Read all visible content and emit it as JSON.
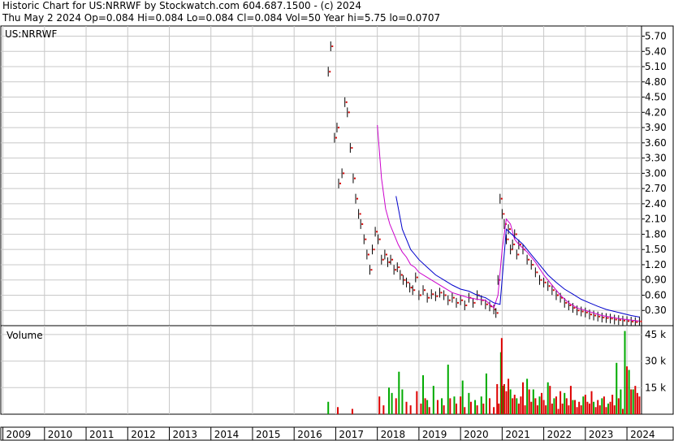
{
  "header": {
    "line1": "Historic Chart for US:NRRWF by Stockwatch.com 604.687.1500 - (c) 2024",
    "line2": "Thu May  2 2024  Op=0.084  Hi=0.084  Lo=0.084  Cl=0.084  Vol=50  Year hi=5.75  lo=0.0707"
  },
  "chart_data": [
    {
      "type": "line",
      "title": "US:NRRWF",
      "ylim": [
        0,
        5.9
      ],
      "ytick_labels": [
        "0.30",
        "0.60",
        "0.90",
        "1.20",
        "1.50",
        "1.80",
        "2.10",
        "2.40",
        "2.70",
        "3.00",
        "3.30",
        "3.60",
        "3.90",
        "4.20",
        "4.50",
        "4.80",
        "5.10",
        "5.40",
        "5.70"
      ],
      "x_labels": [
        "2009",
        "2010",
        "2011",
        "2012",
        "2013",
        "2014",
        "2015",
        "2016",
        "2017",
        "2018",
        "2019",
        "2020",
        "2021",
        "2022",
        "2023",
        "2024"
      ],
      "x_domain": [
        2008.95,
        2024.35
      ],
      "grid": true,
      "colors": {
        "price": "#000000",
        "close_dots": "#d40000",
        "ma_short": "#cc00cc",
        "ma_long": "#0000cc"
      },
      "series": [
        {
          "role": "price",
          "x": [
            2016.82,
            2016.88,
            2016.97,
            2017.03,
            2017.07,
            2017.15,
            2017.22,
            2017.28,
            2017.35,
            2017.42,
            2017.48,
            2017.55,
            2017.6,
            2017.68,
            2017.75,
            2017.82,
            2017.88,
            2017.95,
            2018.02,
            2018.1,
            2018.18,
            2018.25,
            2018.32,
            2018.4,
            2018.48,
            2018.55,
            2018.62,
            2018.7,
            2018.78,
            2018.85,
            2018.92,
            2019.0,
            2019.1,
            2019.2,
            2019.3,
            2019.4,
            2019.5,
            2019.6,
            2019.7,
            2019.8,
            2019.9,
            2020.0,
            2020.1,
            2020.2,
            2020.3,
            2020.4,
            2020.5,
            2020.6,
            2020.7,
            2020.8,
            2020.85,
            2020.9,
            2020.95,
            2021.0,
            2021.05,
            2021.1,
            2021.15,
            2021.2,
            2021.25,
            2021.3,
            2021.35,
            2021.4,
            2021.5,
            2021.6,
            2021.7,
            2021.8,
            2021.9,
            2022.0,
            2022.1,
            2022.2,
            2022.3,
            2022.4,
            2022.5,
            2022.6,
            2022.7,
            2022.8,
            2022.9,
            2023.0,
            2023.1,
            2023.2,
            2023.3,
            2023.4,
            2023.5,
            2023.6,
            2023.7,
            2023.8,
            2023.9,
            2024.0,
            2024.1,
            2024.2,
            2024.3
          ],
          "y": [
            5.0,
            5.5,
            3.7,
            3.9,
            2.8,
            3.0,
            4.4,
            4.2,
            3.5,
            2.9,
            2.5,
            2.2,
            2.0,
            1.7,
            1.4,
            1.1,
            1.5,
            1.85,
            1.7,
            1.3,
            1.4,
            1.25,
            1.3,
            1.1,
            1.15,
            1.0,
            0.9,
            0.85,
            0.75,
            0.7,
            0.95,
            0.6,
            0.7,
            0.55,
            0.62,
            0.58,
            0.65,
            0.6,
            0.5,
            0.55,
            0.45,
            0.5,
            0.4,
            0.55,
            0.45,
            0.6,
            0.5,
            0.42,
            0.38,
            0.32,
            0.25,
            0.9,
            2.5,
            2.2,
            2.0,
            1.7,
            1.9,
            1.5,
            1.6,
            1.8,
            1.4,
            1.6,
            1.5,
            1.3,
            1.2,
            1.05,
            0.9,
            0.85,
            0.78,
            0.7,
            0.6,
            0.55,
            0.45,
            0.4,
            0.35,
            0.3,
            0.28,
            0.26,
            0.22,
            0.2,
            0.18,
            0.16,
            0.15,
            0.14,
            0.12,
            0.11,
            0.1,
            0.09,
            0.08,
            0.07,
            0.084
          ]
        },
        {
          "role": "ma_short",
          "x": [
            2018.0,
            2018.1,
            2018.2,
            2018.3,
            2018.4,
            2018.5,
            2018.6,
            2018.7,
            2018.8,
            2018.9,
            2019.0,
            2019.2,
            2019.4,
            2019.6,
            2019.8,
            2020.0,
            2020.2,
            2020.4,
            2020.6,
            2020.8,
            2020.9,
            2021.0,
            2021.1,
            2021.2,
            2021.3,
            2021.4,
            2021.6,
            2021.8,
            2022.0,
            2022.2,
            2022.4,
            2022.6,
            2022.8,
            2023.0,
            2023.2,
            2023.4,
            2023.6,
            2023.8,
            2024.0,
            2024.2,
            2024.3
          ],
          "y": [
            3.95,
            2.9,
            2.3,
            2.0,
            1.8,
            1.6,
            1.45,
            1.35,
            1.2,
            1.15,
            1.05,
            0.95,
            0.85,
            0.75,
            0.65,
            0.6,
            0.55,
            0.52,
            0.5,
            0.35,
            0.6,
            1.5,
            2.1,
            2.0,
            1.7,
            1.6,
            1.45,
            1.25,
            1.0,
            0.8,
            0.6,
            0.45,
            0.35,
            0.3,
            0.25,
            0.2,
            0.17,
            0.14,
            0.12,
            0.1,
            0.09
          ]
        },
        {
          "role": "ma_long",
          "x": [
            2018.45,
            2018.6,
            2018.8,
            2019.0,
            2019.2,
            2019.4,
            2019.6,
            2019.8,
            2020.0,
            2020.2,
            2020.4,
            2020.6,
            2020.8,
            2020.95,
            2021.1,
            2021.3,
            2021.5,
            2021.7,
            2021.9,
            2022.1,
            2022.3,
            2022.5,
            2022.7,
            2022.9,
            2023.1,
            2023.3,
            2023.5,
            2023.7,
            2023.9,
            2024.1,
            2024.3
          ],
          "y": [
            2.55,
            1.9,
            1.5,
            1.3,
            1.15,
            1.0,
            0.9,
            0.8,
            0.72,
            0.68,
            0.6,
            0.55,
            0.45,
            0.42,
            1.9,
            1.75,
            1.6,
            1.4,
            1.2,
            1.0,
            0.85,
            0.72,
            0.62,
            0.52,
            0.45,
            0.38,
            0.32,
            0.28,
            0.24,
            0.2,
            0.17
          ]
        }
      ]
    },
    {
      "type": "bar",
      "title": "Volume",
      "ylim": [
        0,
        50
      ],
      "ytick_labels": [
        "15 k",
        "30 k",
        "45 k"
      ],
      "colors": {
        "up": "#00aa00",
        "down": "#dd0000"
      },
      "series": [
        {
          "role": "up",
          "x": [
            2016.82,
            2018.28,
            2018.35,
            2018.52,
            2018.6,
            2019.1,
            2019.2,
            2019.35,
            2019.55,
            2019.7,
            2019.85,
            2020.05,
            2020.2,
            2020.35,
            2020.5,
            2020.62,
            2020.97,
            2021.02,
            2021.2,
            2021.35,
            2021.6,
            2021.75,
            2021.9,
            2022.1,
            2022.25,
            2022.5,
            2022.7,
            2022.95,
            2023.2,
            2023.4,
            2023.55,
            2023.75,
            2023.85,
            2023.95,
            2024.05,
            2024.15
          ],
          "y": [
            7,
            15,
            12,
            24,
            14,
            22,
            8,
            16,
            9,
            28,
            10,
            19,
            12,
            8,
            10,
            23,
            35,
            16,
            14,
            9,
            20,
            14,
            10,
            18,
            9,
            12,
            8,
            10,
            7,
            9,
            6,
            29,
            14,
            47,
            25,
            14
          ]
        },
        {
          "role": "down",
          "x": [
            2017.05,
            2017.4,
            2018.05,
            2018.15,
            2018.45,
            2018.7,
            2018.8,
            2018.95,
            2019.05,
            2019.15,
            2019.25,
            2019.45,
            2019.6,
            2019.75,
            2019.9,
            2020.0,
            2020.1,
            2020.25,
            2020.4,
            2020.55,
            2020.7,
            2020.8,
            2020.88,
            2020.92,
            2020.99,
            2021.05,
            2021.1,
            2021.15,
            2021.25,
            2021.3,
            2021.4,
            2021.45,
            2021.5,
            2021.55,
            2021.65,
            2021.7,
            2021.8,
            2021.85,
            2021.95,
            2022.0,
            2022.05,
            2022.15,
            2022.2,
            2022.3,
            2022.35,
            2022.4,
            2022.45,
            2022.55,
            2022.6,
            2022.65,
            2022.75,
            2022.8,
            2022.85,
            2022.9,
            2023.0,
            2023.05,
            2023.1,
            2023.15,
            2023.25,
            2023.3,
            2023.35,
            2023.45,
            2023.5,
            2023.6,
            2023.65,
            2023.7,
            2023.8,
            2023.9,
            2024.0,
            2024.1,
            2024.2,
            2024.25,
            2024.3
          ],
          "y": [
            4,
            3,
            10,
            5,
            9,
            7,
            5,
            13,
            6,
            9,
            4,
            8,
            5,
            9,
            6,
            10,
            4,
            7,
            5,
            6,
            9,
            4,
            17,
            6,
            43,
            17,
            13,
            20,
            9,
            11,
            6,
            10,
            18,
            5,
            14,
            7,
            9,
            5,
            12,
            8,
            5,
            16,
            6,
            10,
            3,
            13,
            6,
            9,
            5,
            16,
            8,
            4,
            7,
            5,
            11,
            7,
            6,
            13,
            4,
            8,
            5,
            10,
            4,
            7,
            11,
            5,
            9,
            3,
            27,
            14,
            16,
            12,
            10
          ]
        }
      ]
    },
    {
      "type": "area",
      "role": "time_axis",
      "x_labels": [
        "2009",
        "2010",
        "2011",
        "2012",
        "2013",
        "2014",
        "2015",
        "2016",
        "2017",
        "2018",
        "2019",
        "2020",
        "2021",
        "2022",
        "2023",
        "2024"
      ]
    }
  ]
}
